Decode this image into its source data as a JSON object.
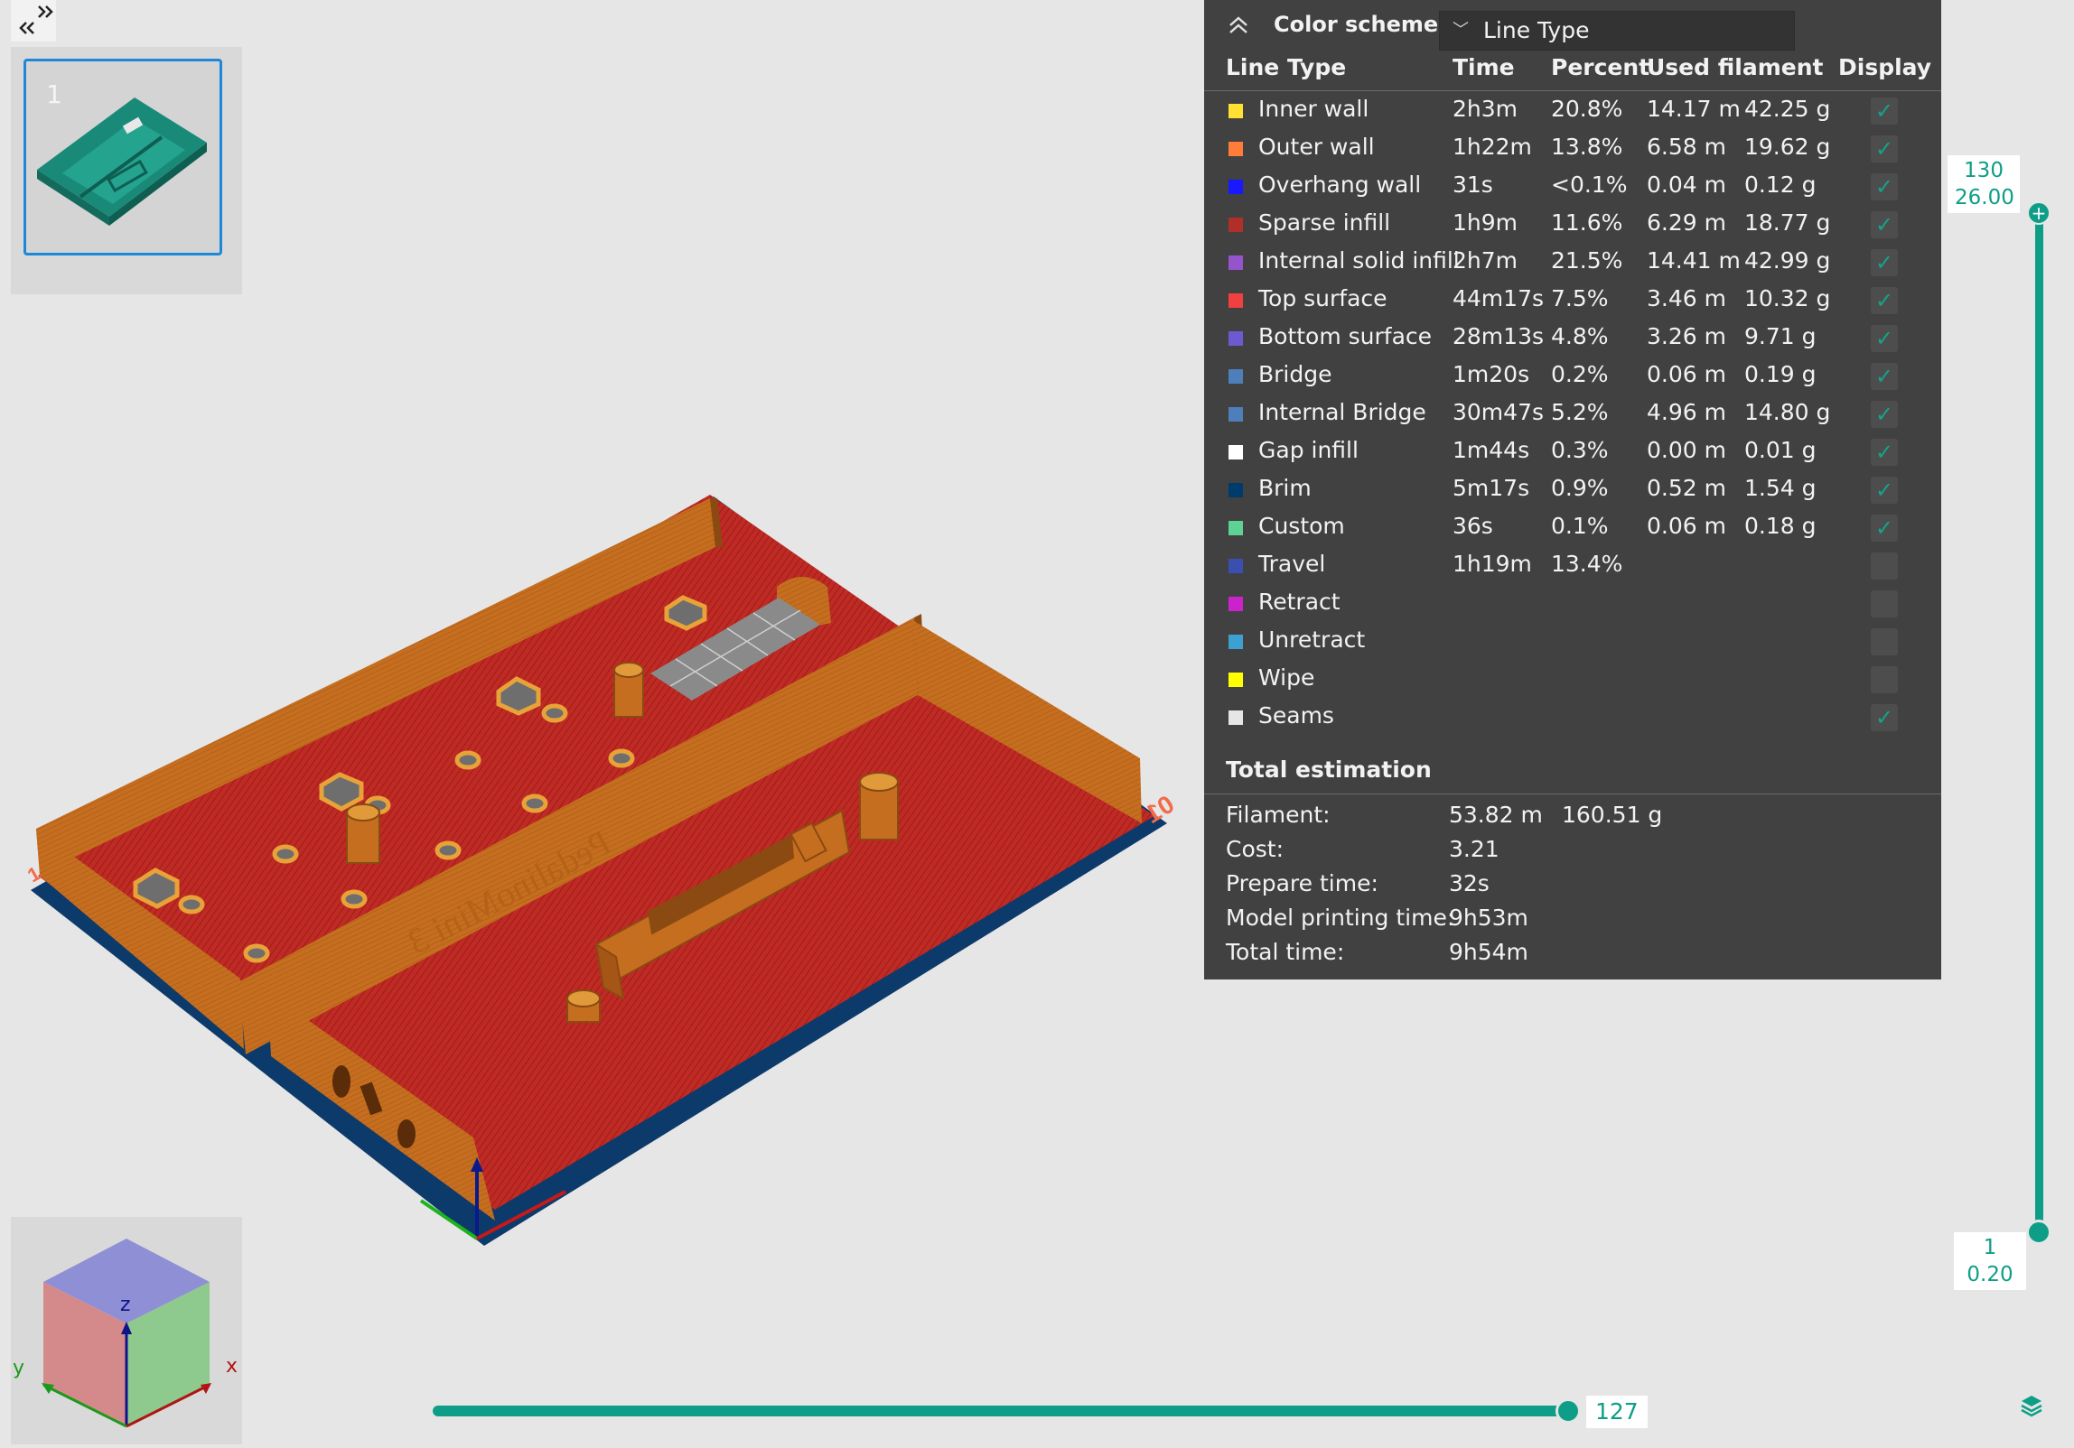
{
  "sidebar": {
    "collapse_label": "<< >>",
    "plate_number": "1"
  },
  "scene": {
    "model_text_left": "PedalinoMini 3",
    "bed_label": "01"
  },
  "legend": {
    "scheme_title": "Color scheme",
    "scheme_value": "Line Type",
    "headers": {
      "line_type": "Line Type",
      "time": "Time",
      "percent": "Percent",
      "used_filament": "Used filament",
      "display": "Display"
    },
    "rows": [
      {
        "name": "Inner wall",
        "time": "2h3m",
        "percent": "20.8%",
        "length": "14.17 m",
        "weight": "42.25 g",
        "color": "#ffe033",
        "display": true
      },
      {
        "name": "Outer wall",
        "time": "1h22m",
        "percent": "13.8%",
        "length": "6.58 m",
        "weight": "19.62 g",
        "color": "#ff7d38",
        "display": true
      },
      {
        "name": "Overhang wall",
        "time": "31s",
        "percent": "<0.1%",
        "length": "0.04 m",
        "weight": "0.12 g",
        "color": "#1919ff",
        "display": true
      },
      {
        "name": "Sparse infill",
        "time": "1h9m",
        "percent": "11.6%",
        "length": "6.29 m",
        "weight": "18.77 g",
        "color": "#b03029",
        "display": true
      },
      {
        "name": "Internal solid infill",
        "time": "2h7m",
        "percent": "21.5%",
        "length": "14.41 m",
        "weight": "42.99 g",
        "color": "#9654cc",
        "display": true
      },
      {
        "name": "Top surface",
        "time": "44m17s",
        "percent": "7.5%",
        "length": "3.46 m",
        "weight": "10.32 g",
        "color": "#f04040",
        "display": true
      },
      {
        "name": "Bottom surface",
        "time": "28m13s",
        "percent": "4.8%",
        "length": "3.26 m",
        "weight": "9.71 g",
        "color": "#6e5ad0",
        "display": true
      },
      {
        "name": "Bridge",
        "time": "1m20s",
        "percent": "0.2%",
        "length": "0.06 m",
        "weight": "0.19 g",
        "color": "#4d80ba",
        "display": true
      },
      {
        "name": "Internal Bridge",
        "time": "30m47s",
        "percent": "5.2%",
        "length": "4.96 m",
        "weight": "14.80 g",
        "color": "#4d80ba",
        "display": true
      },
      {
        "name": "Gap infill",
        "time": "1m44s",
        "percent": "0.3%",
        "length": "0.00 m",
        "weight": "0.01 g",
        "color": "#ffffff",
        "display": true
      },
      {
        "name": "Brim",
        "time": "5m17s",
        "percent": "0.9%",
        "length": "0.52 m",
        "weight": "1.54 g",
        "color": "#003b6e",
        "display": true
      },
      {
        "name": "Custom",
        "time": "36s",
        "percent": "0.1%",
        "length": "0.06 m",
        "weight": "0.18 g",
        "color": "#5ed194",
        "display": true
      },
      {
        "name": "Travel",
        "time": "1h19m",
        "percent": "13.4%",
        "length": "",
        "weight": "",
        "color": "#3a4fb0",
        "display": false
      },
      {
        "name": "Retract",
        "time": "",
        "percent": "",
        "length": "",
        "weight": "",
        "color": "#cc22cc",
        "display": false
      },
      {
        "name": "Unretract",
        "time": "",
        "percent": "",
        "length": "",
        "weight": "",
        "color": "#3ca0d0",
        "display": false
      },
      {
        "name": "Wipe",
        "time": "",
        "percent": "",
        "length": "",
        "weight": "",
        "color": "#ffff00",
        "display": false
      },
      {
        "name": "Seams",
        "time": "",
        "percent": "",
        "length": "",
        "weight": "",
        "color": "#e6e6e6",
        "display": true
      }
    ],
    "total_title": "Total estimation",
    "totals": [
      {
        "key": "Filament:",
        "v1": "53.82 m",
        "v2": "160.51 g"
      },
      {
        "key": "Cost:",
        "v1": "3.21",
        "v2": ""
      },
      {
        "key": "Prepare time:",
        "v1": "32s",
        "v2": ""
      },
      {
        "key": "Model printing time:",
        "v1": "9h53m",
        "v2": ""
      },
      {
        "key": "Total time:",
        "v1": "9h54m",
        "v2": ""
      }
    ]
  },
  "layer_slider": {
    "top_layer": "130",
    "top_height": "26.00",
    "bottom_layer": "1",
    "bottom_height": "0.20"
  },
  "move_slider": {
    "value": "127",
    "fraction": 0.98
  },
  "navcube": {
    "x_label": "x",
    "y_label": "y",
    "z_label": "z"
  },
  "colors": {
    "accent": "#0e9e87",
    "panel_bg": "#414141",
    "viewport_bg": "#e6e6e6",
    "infill_red": "#b22222",
    "wall_orange": "#c06a1e",
    "plate_teal": "#1e9a88",
    "selection_blue": "#1e88d8"
  }
}
